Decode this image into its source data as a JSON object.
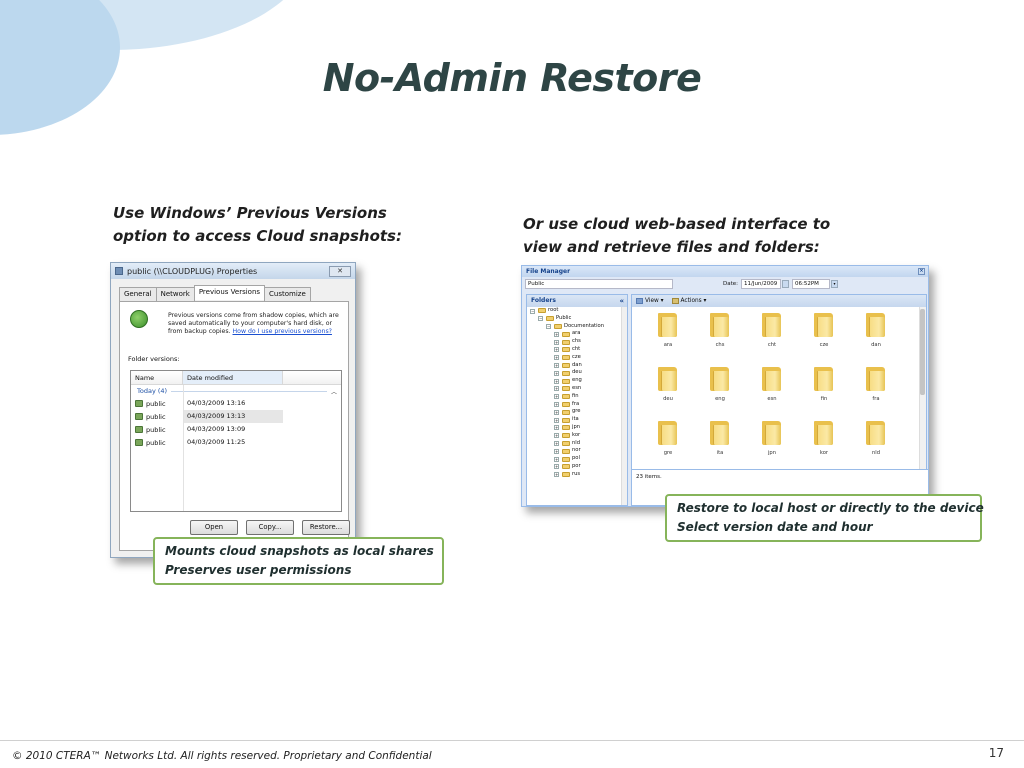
{
  "slide": {
    "title": "No-Admin Restore",
    "left_caption": [
      "Use Windows’ Previous Versions",
      "option to access Cloud snapshots:"
    ],
    "right_caption": [
      "Or use cloud web-based interface to",
      "view and retrieve files and folders:"
    ],
    "left_callout": [
      "Mounts cloud snapshots as local shares",
      "Preserves user permissions"
    ],
    "right_callout": [
      "Restore to local host or directly to the device",
      "Select version date and hour"
    ],
    "footer": "© 2010 CTERA™ Networks Ltd. All rights reserved. Proprietary and Confidential",
    "page_number": "17"
  },
  "win_dialog": {
    "title": "public (\\\\CLOUDPLUG) Properties",
    "close_label": "✕",
    "tabs": [
      "General",
      "Network",
      "Previous Versions",
      "Customize"
    ],
    "active_tab": "Previous Versions",
    "info_text": "Previous versions come from shadow copies, which are saved automatically to your computer's hard disk, or from backup copies.",
    "info_link": "How do I use previous versions?",
    "folder_versions_label": "Folder versions:",
    "columns": [
      "Name",
      "Date modified"
    ],
    "group_label": "Today (4)",
    "rows": [
      {
        "name": "public",
        "date": "04/03/2009 13:16"
      },
      {
        "name": "public",
        "date": "04/03/2009 13:13"
      },
      {
        "name": "public",
        "date": "04/03/2009 13:09"
      },
      {
        "name": "public",
        "date": "04/03/2009 11:25"
      }
    ],
    "selected_row": 1,
    "buttons": {
      "open": "Open",
      "copy": "Copy...",
      "restore": "Restore..."
    }
  },
  "file_manager": {
    "title": "File Manager",
    "path": "Public",
    "date_label": "Date:",
    "date_value": "11/Jun/2009",
    "time_value": "06:52PM",
    "folders_panel_title": "Folders",
    "collapse_label": "«",
    "toolbar": {
      "view": "View ▾",
      "actions": "Actions ▾"
    },
    "tree": [
      {
        "label": "root",
        "depth": 0,
        "exp": "−"
      },
      {
        "label": "Public",
        "depth": 1,
        "exp": "−"
      },
      {
        "label": "Documentation",
        "depth": 2,
        "exp": "−"
      },
      {
        "label": "ara",
        "depth": 3,
        "exp": "+"
      },
      {
        "label": "chs",
        "depth": 3,
        "exp": "+"
      },
      {
        "label": "cht",
        "depth": 3,
        "exp": "+"
      },
      {
        "label": "cze",
        "depth": 3,
        "exp": "+"
      },
      {
        "label": "dan",
        "depth": 3,
        "exp": "+"
      },
      {
        "label": "deu",
        "depth": 3,
        "exp": "+"
      },
      {
        "label": "eng",
        "depth": 3,
        "exp": "+"
      },
      {
        "label": "esn",
        "depth": 3,
        "exp": "+"
      },
      {
        "label": "fin",
        "depth": 3,
        "exp": "+"
      },
      {
        "label": "fra",
        "depth": 3,
        "exp": "+"
      },
      {
        "label": "gre",
        "depth": 3,
        "exp": "+"
      },
      {
        "label": "ita",
        "depth": 3,
        "exp": "+"
      },
      {
        "label": "jpn",
        "depth": 3,
        "exp": "+"
      },
      {
        "label": "kor",
        "depth": 3,
        "exp": "+"
      },
      {
        "label": "nld",
        "depth": 3,
        "exp": "+"
      },
      {
        "label": "nor",
        "depth": 3,
        "exp": "+"
      },
      {
        "label": "pol",
        "depth": 3,
        "exp": "+"
      },
      {
        "label": "por",
        "depth": 3,
        "exp": "+"
      },
      {
        "label": "rus",
        "depth": 3,
        "exp": "+"
      }
    ],
    "grid_items": [
      "ara",
      "chs",
      "cht",
      "cze",
      "dan",
      "deu",
      "eng",
      "esn",
      "fin",
      "fra",
      "gre",
      "ita",
      "jpn",
      "kor",
      "nld",
      "",
      "",
      "",
      "",
      ""
    ],
    "status": "23 items."
  },
  "colors": {
    "title": "#2e4545",
    "callout_border": "#86b45a",
    "deco_blue": "#bcd8ee"
  }
}
